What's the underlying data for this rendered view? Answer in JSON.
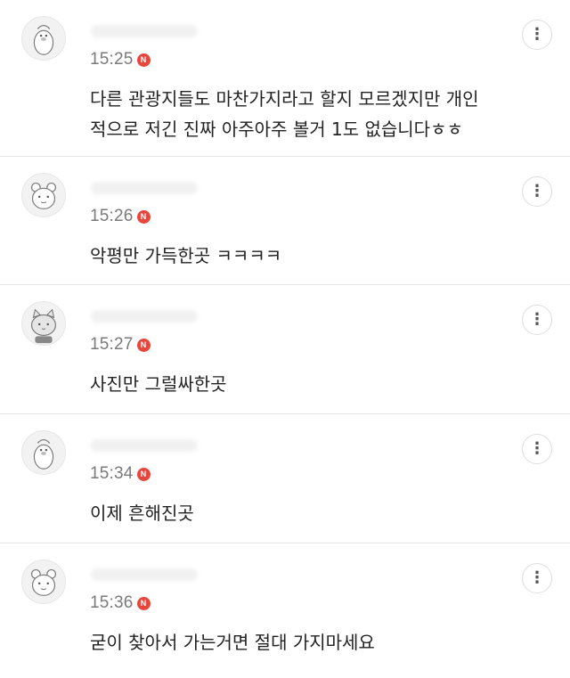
{
  "badge_label": "N",
  "colors": {
    "badge": "#e8453c",
    "divider": "#e4e4e4",
    "time": "#7a7a7a",
    "text": "#222222"
  },
  "comments": [
    {
      "time": "15:25",
      "text": "다른 관광지들도 마찬가지라고 할지 모르겠지만 개인\n적으로 저긴 진짜 아주아주 볼거 1도 없습니다ㅎㅎ",
      "avatar": "penguin-icon"
    },
    {
      "time": "15:26",
      "text": "악평만 가득한곳 ㅋㅋㅋㅋ",
      "avatar": "bear-icon"
    },
    {
      "time": "15:27",
      "text": "사진만 그럴싸한곳",
      "avatar": "cat-icon"
    },
    {
      "time": "15:34",
      "text": "이제 흔해진곳",
      "avatar": "penguin-icon"
    },
    {
      "time": "15:36",
      "text": "굳이 찾아서 가는거면 절대 가지마세요",
      "avatar": "bear-icon"
    }
  ]
}
